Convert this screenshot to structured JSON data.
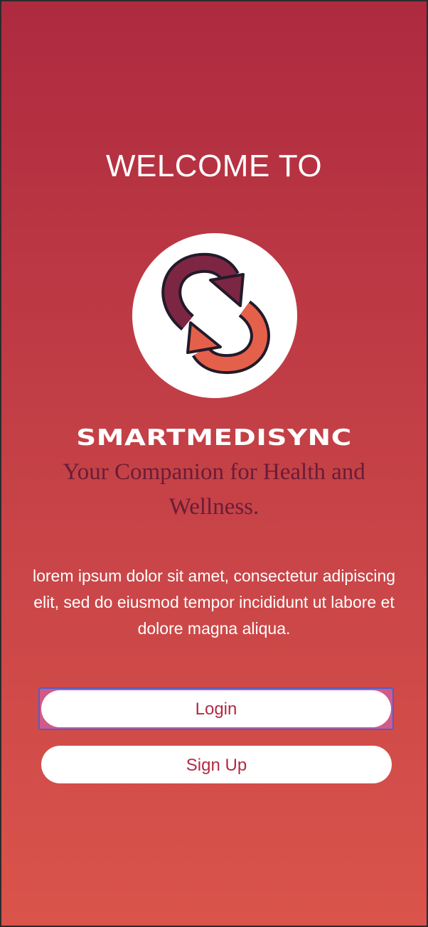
{
  "welcome": {
    "heading": "WELCOME TO",
    "logo_icon": "sync-arrows-icon",
    "app_name": "SMARTMEDISYNC",
    "tagline": "Your Companion for Health and Wellness.",
    "description": "lorem ipsum dolor sit amet, consectetur adipiscing elit, sed do eiusmod tempor incididunt ut labore et dolore magna aliqua."
  },
  "actions": {
    "login_label": "Login",
    "signup_label": "Sign Up"
  },
  "colors": {
    "gradient_top": "#ae2a3f",
    "gradient_bottom": "#da544b",
    "tagline": "#6a1c36",
    "button_text": "#b22a43",
    "focus_ring": "#4f5fc8"
  }
}
